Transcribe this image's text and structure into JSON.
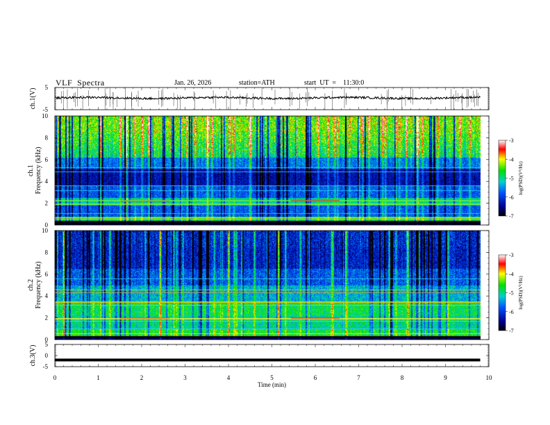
{
  "header": {
    "title": "VLF  Spectra",
    "date": "Jan. 26, 2026",
    "station": "station=ATH",
    "start": "start  UT  =    11:30:0"
  },
  "chart_data": [
    {
      "id": "ch1-waveform",
      "type": "line",
      "ylabel": "ch.1(V)",
      "ylim": [
        -5,
        5
      ],
      "yticks": [
        "5",
        "-5"
      ],
      "x_range_min": [
        0,
        9.8
      ],
      "description_series": "black waveform trace centred slightly above 0 V with spike bursts"
    },
    {
      "id": "ch1-spectrogram",
      "type": "heatmap",
      "ylabel": "ch.1\nFrequency (kHz)",
      "ylim": [
        0,
        10
      ],
      "yticks": [
        "0",
        "2",
        "4",
        "6",
        "8",
        "10"
      ],
      "x_range_min": [
        0,
        9.8
      ],
      "colorbar": {
        "label": "log(PSD)(V²/Hz)",
        "range": [
          -7,
          -3
        ],
        "ticks": [
          "-3",
          "-4",
          "-5",
          "-6",
          "-7"
        ]
      }
    },
    {
      "id": "ch2-spectrogram",
      "type": "heatmap",
      "ylabel": "ch.2\nFrequency (kHz)",
      "ylim": [
        0,
        10
      ],
      "yticks": [
        "0",
        "2",
        "4",
        "6",
        "8",
        "10"
      ],
      "x_range_min": [
        0,
        9.8
      ],
      "colorbar": {
        "label": "log(PSD)(V²/Hz)",
        "range": [
          -7,
          -3
        ],
        "ticks": [
          "-3",
          "-4",
          "-5",
          "-6",
          "-7"
        ]
      }
    },
    {
      "id": "ch3-waveform",
      "type": "line",
      "ylabel": "ch.3(V)",
      "ylim": [
        -5,
        5
      ],
      "yticks": [
        "5",
        "0",
        "-5"
      ],
      "x_range_min": [
        0,
        9.8
      ],
      "description_series": "flat thick trace near -2 V"
    }
  ],
  "xaxis": {
    "label": "Time  (min)",
    "range": [
      0,
      10
    ],
    "ticks": [
      "0",
      "1",
      "2",
      "3",
      "4",
      "5",
      "6",
      "7",
      "8",
      "9",
      "10"
    ]
  },
  "labels": {
    "ch1_wave": "ch.1(V)",
    "ch1_a": "ch.1",
    "ch1_b": "Frequency  (kHz)",
    "ch2_a": "ch.2",
    "ch2_b": "Frequency  (kHz)",
    "ch3_wave": "ch.3(V)",
    "cbar": "log(PSD)(V²/Hz)"
  }
}
